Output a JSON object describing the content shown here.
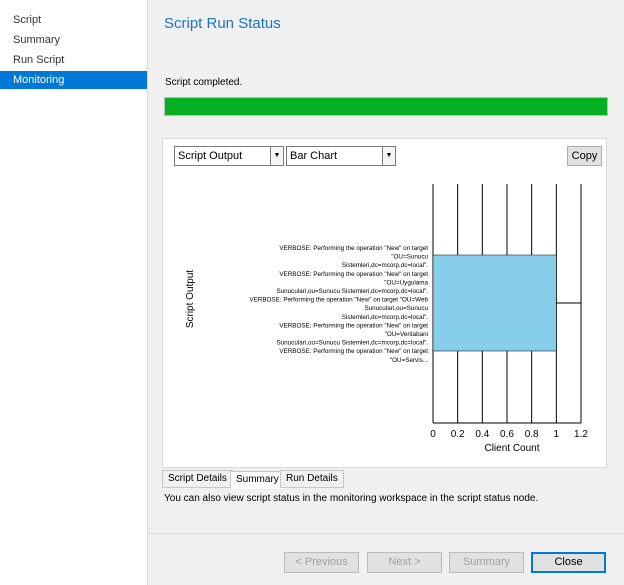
{
  "sidebar": {
    "items": [
      {
        "label": "Script",
        "active": false
      },
      {
        "label": "Summary",
        "active": false
      },
      {
        "label": "Run Script",
        "active": false
      },
      {
        "label": "Monitoring",
        "active": true
      }
    ]
  },
  "main": {
    "title": "Script Run Status",
    "status_text": "Script completed.",
    "progress": 1.0,
    "colors": {
      "accent": "#0078d7",
      "title": "#1e73be",
      "progress": "#06b025",
      "bar": "#87ceeb"
    }
  },
  "panel": {
    "output_select": "Script Output",
    "chart_select": "Bar Chart",
    "copy_label": "Copy"
  },
  "chart_data": {
    "type": "bar",
    "orientation": "horizontal",
    "xlabel": "Client Count",
    "ylabel": "Script Output",
    "xlim": [
      0,
      1.2
    ],
    "x_ticks": [
      "0",
      "0.2",
      "0.4",
      "0.6",
      "0.8",
      "1",
      "1.2"
    ],
    "grid": true,
    "categories": [
      "VERBOSE: Performing the operation \"New\" on target \"OU=Sunucu Sistemleri,dc=mcorp,dc=local\". VERBOSE: Performing the operation \"New\" on target \"OU=Uygulama Sunuculari,ou=Sunucu Sistemleri,dc=mcorp,dc=local\". VERBOSE: Performing the operation \"New\" on target \"OU=Web Sunuculari,ou=Sunucu Sistemleri,dc=mcorp,dc=local\". VERBOSE: Performing the operation \"New\" on target \"OU=Veritabani Sunuculari,ou=Sunucu Sistemleri,dc=mcorp,dc=local\". VERBOSE: Performing the operation \"New\" on target \"OU=Servis..."
    ],
    "category_label_lines": [
      "VERBOSE: Performing the operation \"New\" on target",
      "\"OU=Sunucu",
      "Sistemleri,dc=mcorp,dc=local\".",
      "VERBOSE: Performing the operation \"New\" on target",
      "\"OU=Uygulama",
      "Sunuculari,ou=Sunucu  Sistemleri,dc=mcorp,dc=local\".",
      "VERBOSE: Performing the operation \"New\" on target \"OU=Web",
      "Sunuculari,ou=Sunucu",
      "Sistemleri,dc=mcorp,dc=local\".",
      "VERBOSE: Performing the operation \"New\" on target",
      "\"OU=Veritabani",
      "Sunuculari,ou=Sunucu  Sistemleri,dc=mcorp,dc=local\".",
      "VERBOSE: Performing the operation \"New\" on target",
      "\"OU=Servis..."
    ],
    "values": [
      1
    ]
  },
  "tabs": [
    {
      "label": "Script Details",
      "active": false
    },
    {
      "label": "Summary",
      "active": true
    },
    {
      "label": "Run Details",
      "active": false
    }
  ],
  "hint": "You can also view script status in the monitoring workspace in the script status node.",
  "buttons": {
    "previous": "< Previous",
    "next": "Next >",
    "summary": "Summary",
    "close": "Close"
  }
}
